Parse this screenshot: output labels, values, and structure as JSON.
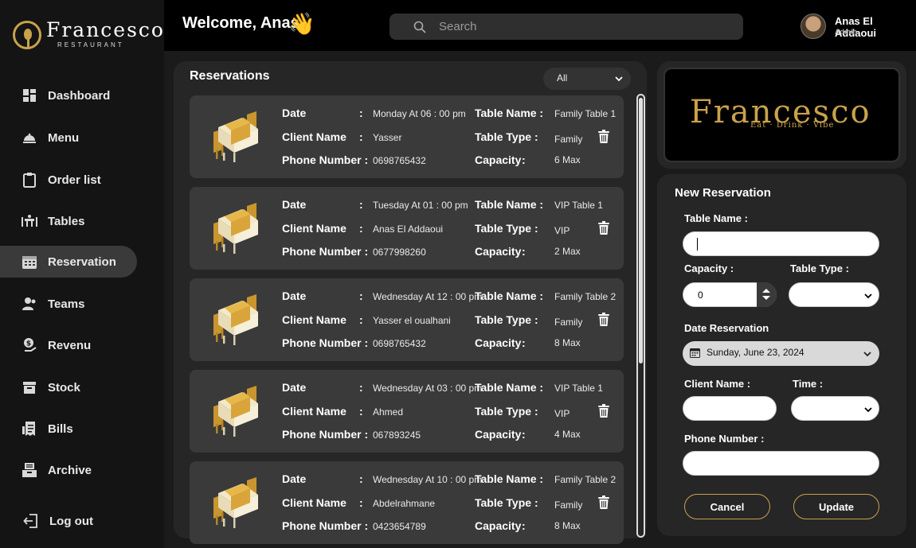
{
  "app": {
    "logo_name": "Francesco",
    "logo_sub": "RESTAURANT"
  },
  "sidebar": {
    "items": [
      {
        "label": "Dashboard"
      },
      {
        "label": "Menu"
      },
      {
        "label": "Order list"
      },
      {
        "label": "Tables"
      },
      {
        "label": "Reservation"
      },
      {
        "label": "Teams"
      },
      {
        "label": "Revenu"
      },
      {
        "label": "Stock"
      },
      {
        "label": "Bills"
      },
      {
        "label": "Archive"
      }
    ],
    "logout": "Log out"
  },
  "header": {
    "welcome": "Welcome, Anas",
    "wave": "👋",
    "search_placeholder": "Search",
    "user_name": "Anas El Addaoui",
    "user_role": "Admin"
  },
  "reservations": {
    "title": "Reservations",
    "filter_value": "All",
    "labels": {
      "date": "Date",
      "client": "Client Name",
      "phone": "Phone Number :",
      "table_name": "Table Name :",
      "table_type": "Table Type :",
      "capacity": "Capacity",
      "colon": ":"
    },
    "items": [
      {
        "date": "Monday At 06 : 00 pm",
        "client": "Yasser",
        "phone": "0698765432",
        "table_name": "Family Table 1",
        "table_type": "Family",
        "capacity": "6 Max"
      },
      {
        "date": "Tuesday At 01 : 00 pm",
        "client": "Anas El Addaoui",
        "phone": "0677998260",
        "table_name": "VIP Table 1",
        "table_type": "VIP",
        "capacity": "2 Max"
      },
      {
        "date": "Wednesday At 12 : 00 pm",
        "client": "Yasser el oualhani",
        "phone": "0698765432",
        "table_name": "Family Table 2",
        "table_type": "Family",
        "capacity": "8 Max"
      },
      {
        "date": "Wednesday At 03 : 00 pm",
        "client": "Ahmed",
        "phone": "067893245",
        "table_name": "VIP Table 1",
        "table_type": "VIP",
        "capacity": "4 Max"
      },
      {
        "date": "Wednesday At 10 : 00 pm",
        "client": "Abdelrahmane",
        "phone": "0423654789",
        "table_name": "Family Table 2",
        "table_type": "Family",
        "capacity": "8 Max"
      }
    ]
  },
  "brand": {
    "name": "Francesco",
    "tagline": "Eat · Drink · Vibe"
  },
  "form": {
    "title": "New Reservation",
    "table_name_label": "Table Name :",
    "table_name_value": "",
    "capacity_label": "Capacity :",
    "capacity_value": "0",
    "table_type_label": "Table Type :",
    "table_type_value": "",
    "date_label": "Date Reservation",
    "date_value": "Sunday, June 23, 2024",
    "client_label": "Client Name :",
    "client_value": "",
    "time_label": "Time :",
    "time_value": "",
    "phone_label": "Phone Number :",
    "phone_value": "",
    "cancel": "Cancel",
    "update": "Update"
  },
  "colors": {
    "accent_gold": "#c9a24a",
    "sidebar_bg": "#141414",
    "card_bg": "#3a3a3a"
  }
}
